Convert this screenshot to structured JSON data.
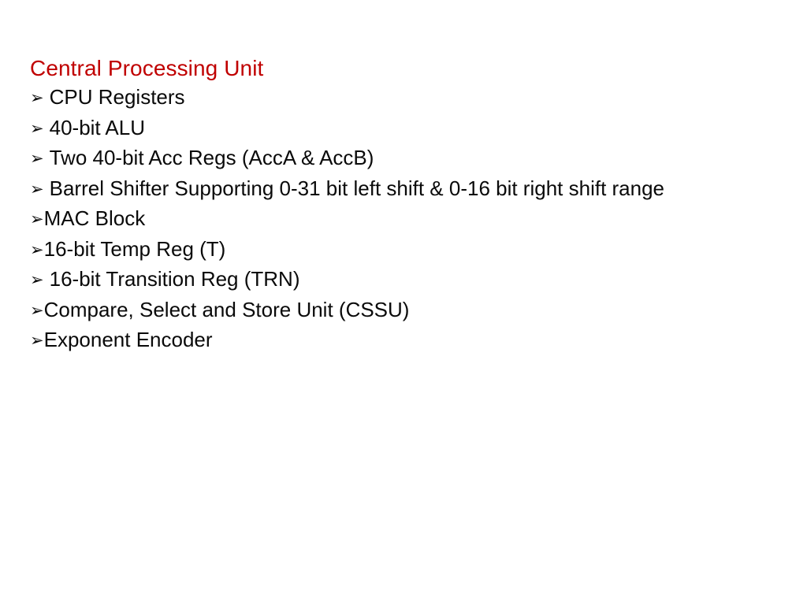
{
  "slide": {
    "background_color": "#FFFFFF",
    "title": {
      "text": "Central Processing Unit",
      "color": "#C00000"
    },
    "body": {
      "text_color": "#0A0A0A",
      "bullet_glyph": "➢",
      "bullet_glyph_name": "arrowhead-bullet",
      "items": [
        {
          "text": "CPU Registers",
          "gap_after_bullet": true
        },
        {
          "text": "40-bit ALU",
          "gap_after_bullet": true
        },
        {
          "text": "Two 40-bit Acc Regs (AccA & AccB)",
          "gap_after_bullet": true
        },
        {
          "text": "Barrel Shifter Supporting 0-31 bit left shift & 0-16 bit right shift range",
          "gap_after_bullet": true
        },
        {
          "text": "MAC Block",
          "gap_after_bullet": false
        },
        {
          "text": "16-bit Temp Reg (T)",
          "gap_after_bullet": false
        },
        {
          "text": "16-bit Transition Reg (TRN)",
          "gap_after_bullet": true
        },
        {
          "text": "Compare, Select and Store Unit (CSSU)",
          "gap_after_bullet": false
        },
        {
          "text": "Exponent Encoder",
          "gap_after_bullet": false
        }
      ]
    }
  }
}
